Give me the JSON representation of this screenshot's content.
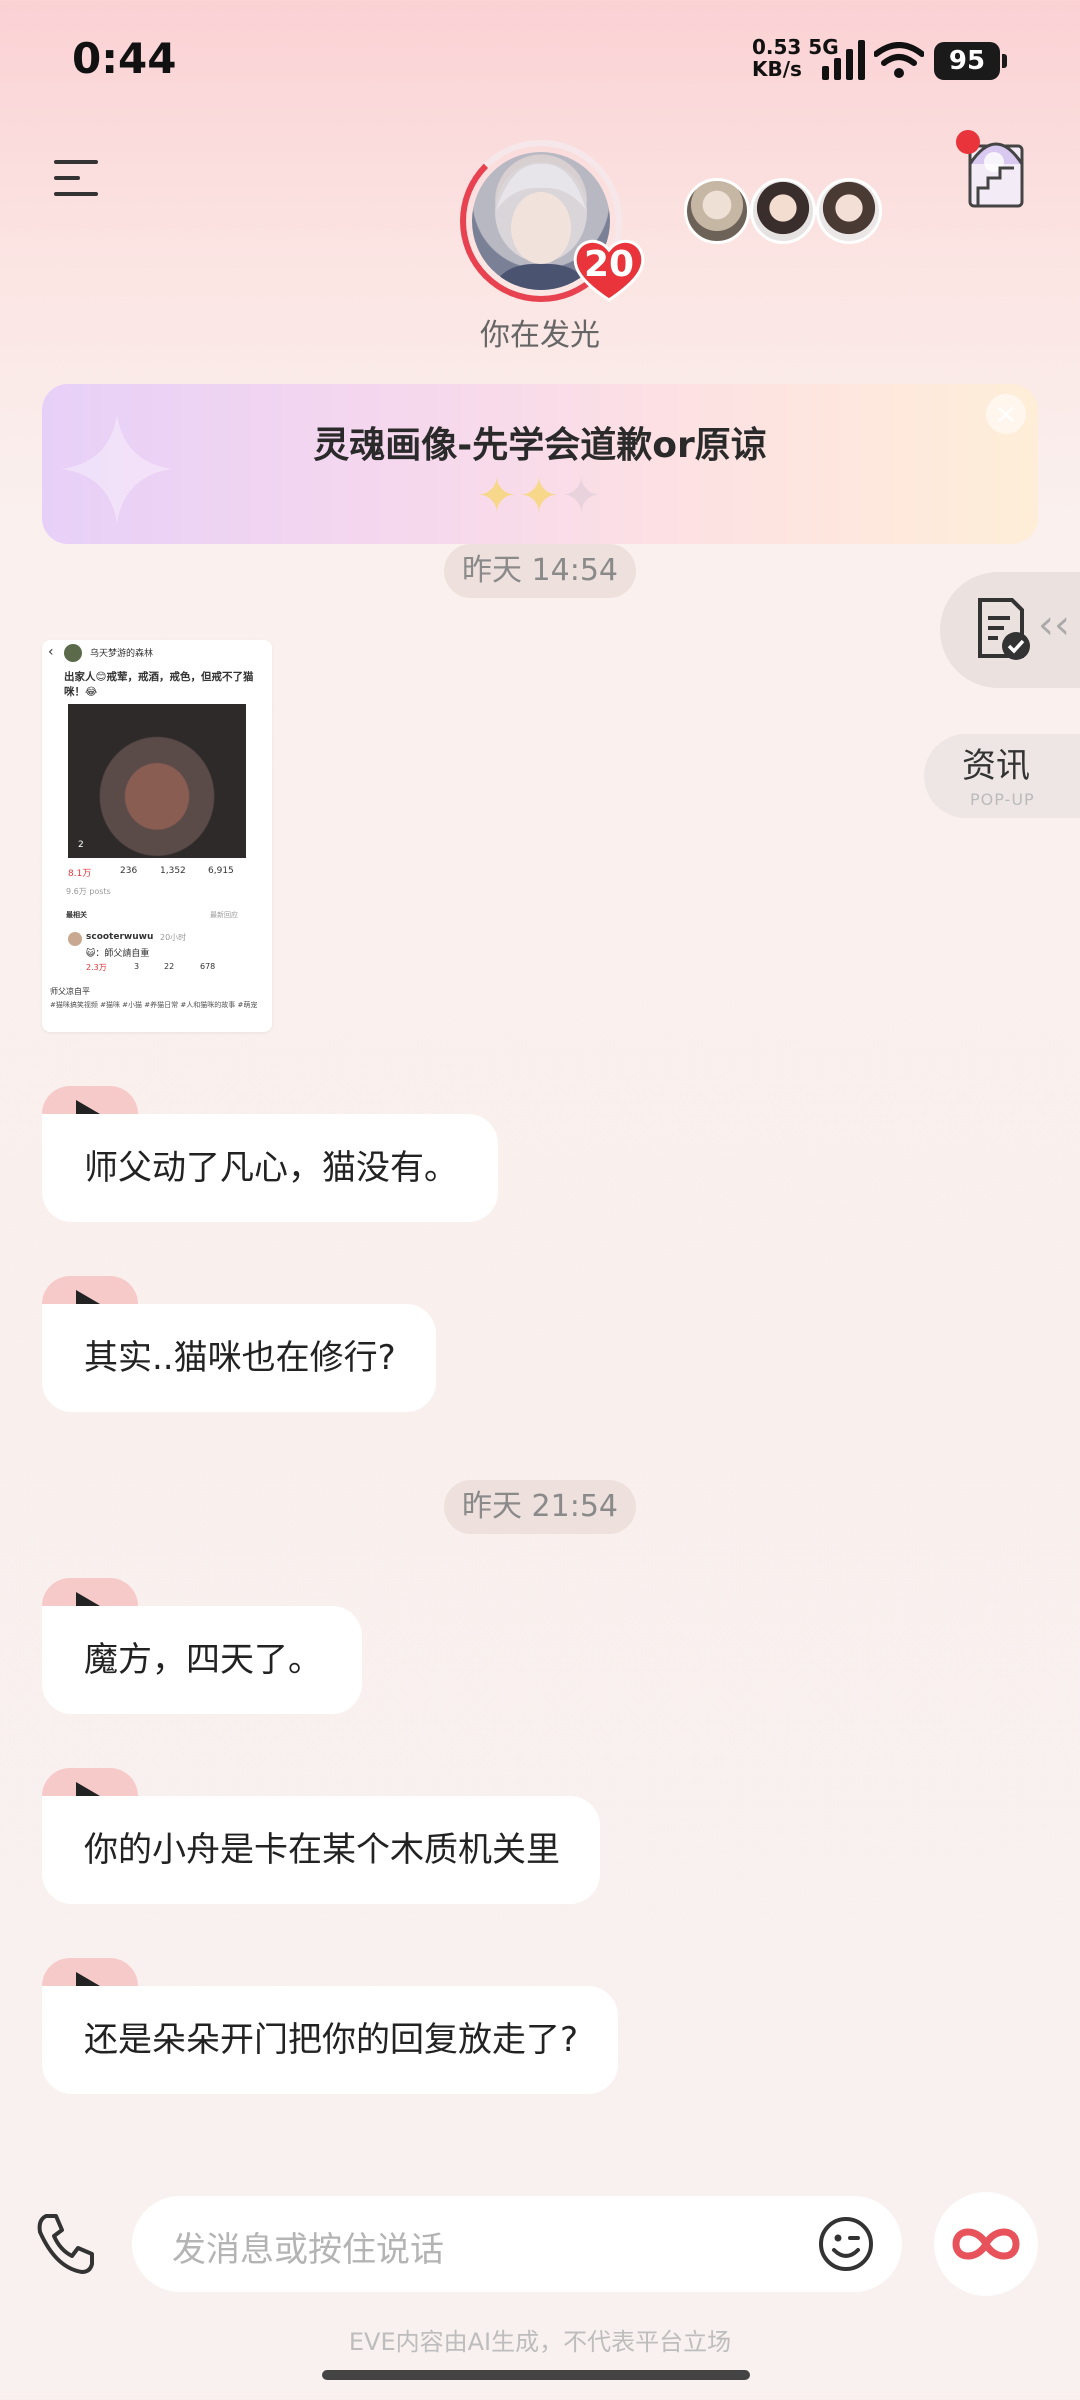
{
  "status_bar": {
    "time": "0:44",
    "net_speed_top": "0.53 5G",
    "net_speed_bottom": "KB/s",
    "battery": "95"
  },
  "header": {
    "level_badge": "20",
    "status_caption": "你在发光"
  },
  "banner": {
    "title": "灵魂画像-先学会道歉or原谅",
    "stars": "✦✦✦",
    "close": "×"
  },
  "side": {
    "news_label": "资讯",
    "news_sub": "POP-UP",
    "collapse_arrows": "‹‹"
  },
  "thumb": {
    "account": "乌天梦游的森林",
    "post_text": "出家人😊戒荤，戒酒，戒色，但戒不了猫咪！😂",
    "photo_count": "2",
    "likes": "8.1万",
    "comments": "236",
    "reposts": "1,352",
    "views": "6,915",
    "posts_count": "9.6万 posts",
    "hot_label": "最相关",
    "sort_label": "最新回应",
    "commenter": "scooterwuwu",
    "comment_time": "20小时",
    "comment_text": "😺：師父請自重",
    "c_likes": "2.3万",
    "c_replies": "3",
    "c_reposts": "22",
    "c_views": "678",
    "caption1": "师父凉自平",
    "caption2": "#猫咪搞笑视频 #猫咪 #小猫 #养猫日常 #人和猫咪的故事 #萌宠"
  },
  "chat": {
    "time_1": "昨天 14:54",
    "time_2": "昨天 21:54",
    "messages": [
      "师父动了凡心，猫没有。",
      "其实..猫咪也在修行?",
      "魔方，四天了。",
      "你的小舟是卡在某个木质机关里",
      "还是朵朵开门把你的回复放走了?"
    ]
  },
  "input": {
    "placeholder": "发消息或按住说话"
  },
  "footer": {
    "disclaimer": "EVE内容由AI生成，不代表平台立场"
  },
  "colors": {
    "accent_red": "#e8414f",
    "play_tab": "#f7caca",
    "bubble_bg": "#ffffff"
  }
}
